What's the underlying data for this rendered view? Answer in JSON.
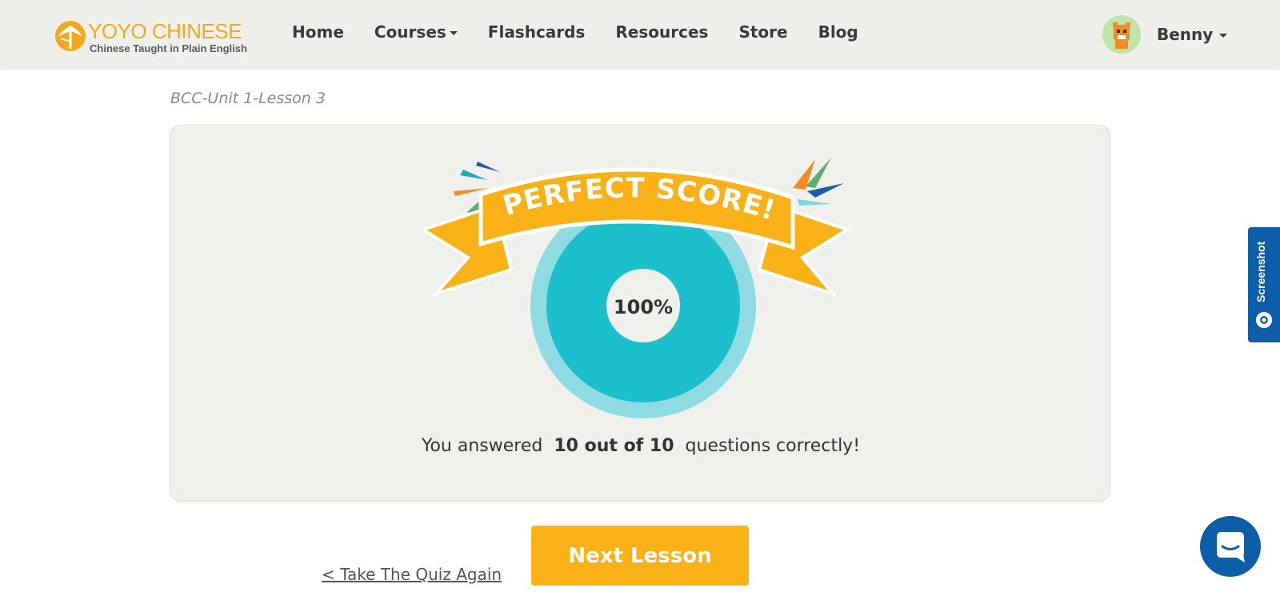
{
  "header": {
    "logo_name": "YOYO CHINESE",
    "logo_tagline": "Chinese Taught in Plain English",
    "nav": [
      {
        "label": "Home",
        "dropdown": false
      },
      {
        "label": "Courses",
        "dropdown": true
      },
      {
        "label": "Flashcards",
        "dropdown": false
      },
      {
        "label": "Resources",
        "dropdown": false
      },
      {
        "label": "Store",
        "dropdown": false
      },
      {
        "label": "Blog",
        "dropdown": false
      }
    ],
    "user_name": "Benny"
  },
  "breadcrumb": "BCC-Unit 1-Lesson 3",
  "result": {
    "banner_text": "PERFECT SCORE!",
    "percent_text": "100%",
    "score_fraction": 1.0,
    "message_prefix": "You answered",
    "message_score": "10 out of 10",
    "message_suffix": "questions correctly!"
  },
  "actions": {
    "retake_label": "< Take The Quiz Again",
    "next_label": "Next Lesson"
  },
  "widgets": {
    "screenshot_label": "Screenshot"
  },
  "colors": {
    "brand_orange": "#fbb218",
    "teal": "#1cc0cc",
    "teal_light": "#8fdbe2",
    "widget_blue": "#0d5ea8"
  }
}
